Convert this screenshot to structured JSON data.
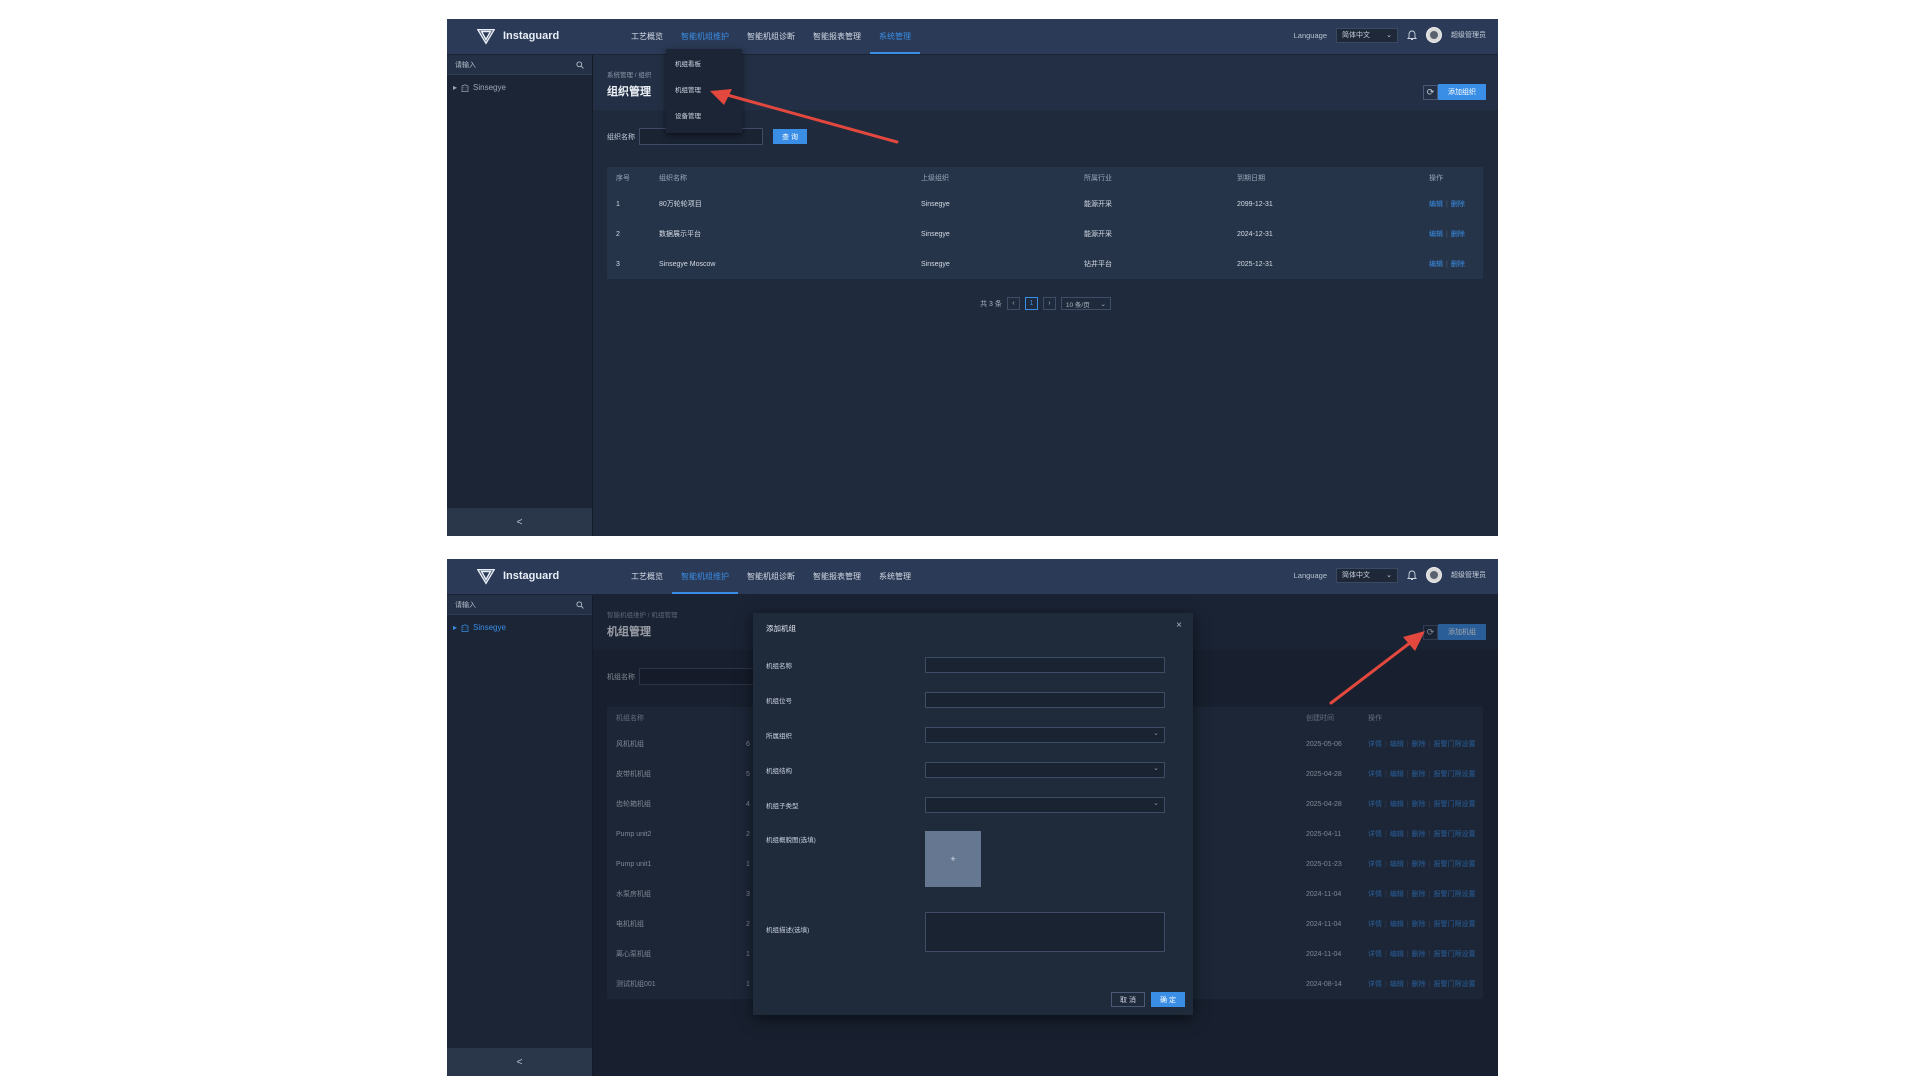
{
  "brand": {
    "name": "Instaguard"
  },
  "nav": {
    "items": [
      "工艺概览",
      "智能机组维护",
      "智能机组诊断",
      "智能报表管理",
      "系统管理"
    ]
  },
  "header": {
    "language_label": "Language",
    "language_value": "简体中文",
    "user_name": "超级管理员"
  },
  "sidebar": {
    "search_placeholder": "请输入",
    "tree_root": "Sinsegye",
    "collapse_glyph": "<"
  },
  "screen1": {
    "breadcrumb": "系统管理 / 组织",
    "title": "组织管理",
    "add_button": "添加组织",
    "filter_label": "组织名称",
    "query_button": "查 询",
    "dropdown": [
      "机组看板",
      "机组管理",
      "设备管理"
    ],
    "table": {
      "columns": [
        "序号",
        "组织名称",
        "上级组织",
        "所属行业",
        "到期日期",
        "操作"
      ],
      "rows": [
        {
          "no": "1",
          "name": "80万轮轮项目",
          "parent": "Sinsegye",
          "industry": "能源开采",
          "expiry": "2099-12-31"
        },
        {
          "no": "2",
          "name": "数据展示平台",
          "parent": "Sinsegye",
          "industry": "能源开采",
          "expiry": "2024-12-31"
        },
        {
          "no": "3",
          "name": "Sinsegye Moscow",
          "parent": "Sinsegye",
          "industry": "钻井平台",
          "expiry": "2025-12-31"
        }
      ],
      "action_edit": "编辑",
      "action_delete": "删除"
    },
    "pager": {
      "total": "共 3 条",
      "current": "1",
      "page_size": "10 条/页"
    }
  },
  "screen2": {
    "breadcrumb": "智能机组维护 / 机组管理",
    "title": "机组管理",
    "add_button": "添加机组",
    "filter_label": "机组名称",
    "columns": [
      "机组名称",
      "创建时间",
      "操作"
    ],
    "rows": [
      {
        "name": "风机机组",
        "num": "6",
        "created": "2025-05-06"
      },
      {
        "name": "皮带机机组",
        "num": "5",
        "created": "2025-04-28"
      },
      {
        "name": "齿轮箱机组",
        "num": "4",
        "created": "2025-04-28"
      },
      {
        "name": "Pump unit2",
        "num": "2",
        "created": "2025-04-11"
      },
      {
        "name": "Pump unit1",
        "num": "1",
        "created": "2025-01-23"
      },
      {
        "name": "水泵房机组",
        "num": "3",
        "created": "2024-11-04"
      },
      {
        "name": "电机机组",
        "num": "2",
        "created": "2024-11-04"
      },
      {
        "name": "离心泵机组",
        "num": "1",
        "created": "2024-11-04"
      },
      {
        "name": "测试机组001",
        "num": "1",
        "created": "2024-08-14"
      }
    ],
    "actions": [
      "详情",
      "编辑",
      "删除",
      "报警门限设置"
    ],
    "modal": {
      "title": "添加机组",
      "fields": [
        "机组名称",
        "机组位号",
        "所属组织",
        "机组结构",
        "机组子类型",
        "机组概貌图(选填)",
        "机组描述(选填)"
      ],
      "upload_glyph": "+",
      "cancel": "取 消",
      "confirm": "确 定"
    }
  },
  "colors": {
    "accent": "#3a8ee6",
    "arrow": "#e2483d",
    "background": "#1f2a3c"
  }
}
